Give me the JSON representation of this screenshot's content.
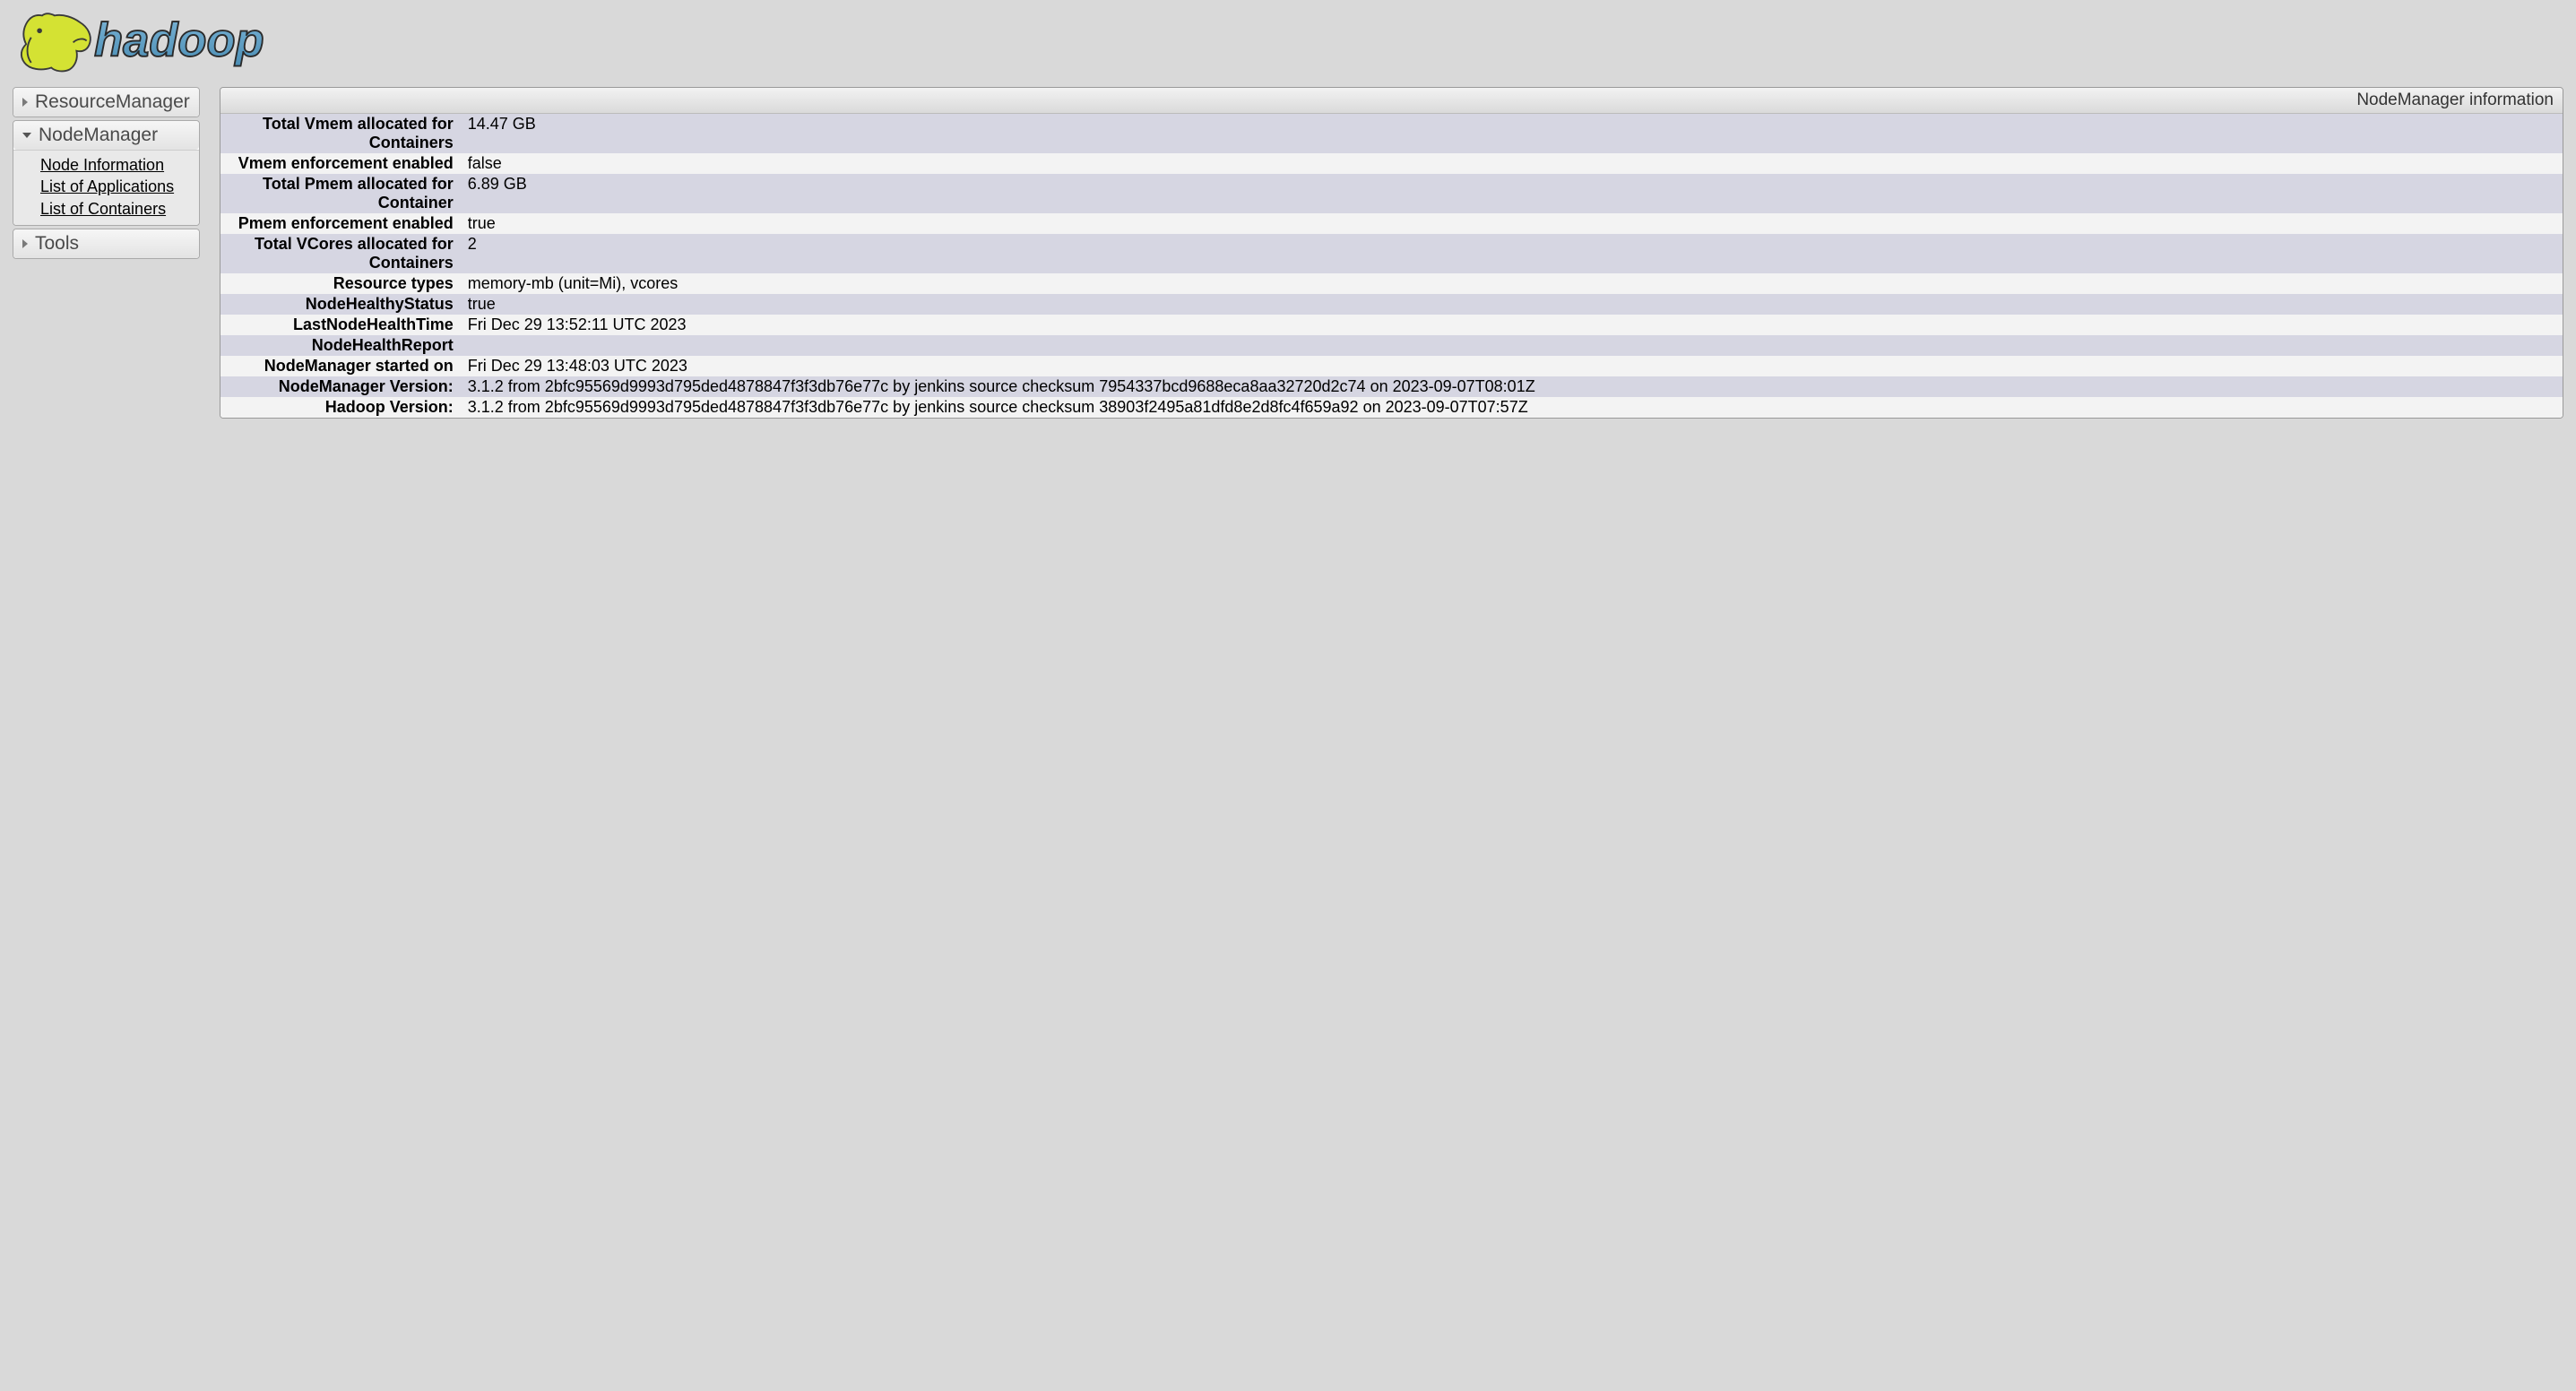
{
  "logo_text": "hadoop",
  "sidebar": {
    "resource_manager_label": "ResourceManager",
    "node_manager_label": "NodeManager",
    "node_manager_items": {
      "node_info": "Node Information",
      "list_apps": "List of Applications",
      "list_containers": "List of Containers"
    },
    "tools_label": "Tools"
  },
  "main": {
    "title": "NodeManager information",
    "rows": [
      {
        "label": "Total Vmem allocated for Containers",
        "value": "14.47 GB"
      },
      {
        "label": "Vmem enforcement enabled",
        "value": "false"
      },
      {
        "label": "Total Pmem allocated for Container",
        "value": "6.89 GB"
      },
      {
        "label": "Pmem enforcement enabled",
        "value": "true"
      },
      {
        "label": "Total VCores allocated for Containers",
        "value": "2"
      },
      {
        "label": "Resource types",
        "value": "memory-mb (unit=Mi), vcores"
      },
      {
        "label": "NodeHealthyStatus",
        "value": "true"
      },
      {
        "label": "LastNodeHealthTime",
        "value": "Fri Dec 29 13:52:11 UTC 2023"
      },
      {
        "label": "NodeHealthReport",
        "value": ""
      },
      {
        "label": "NodeManager started on",
        "value": "Fri Dec 29 13:48:03 UTC 2023"
      },
      {
        "label": "NodeManager Version:",
        "value": "3.1.2 from 2bfc95569d9993d795ded4878847f3f3db76e77c by jenkins source checksum 7954337bcd9688eca8aa32720d2c74 on 2023-09-07T08:01Z"
      },
      {
        "label": "Hadoop Version:",
        "value": "3.1.2 from 2bfc95569d9993d795ded4878847f3f3db76e77c by jenkins source checksum 38903f2495a81dfd8e2d8fc4f659a92 on 2023-09-07T07:57Z"
      }
    ]
  }
}
